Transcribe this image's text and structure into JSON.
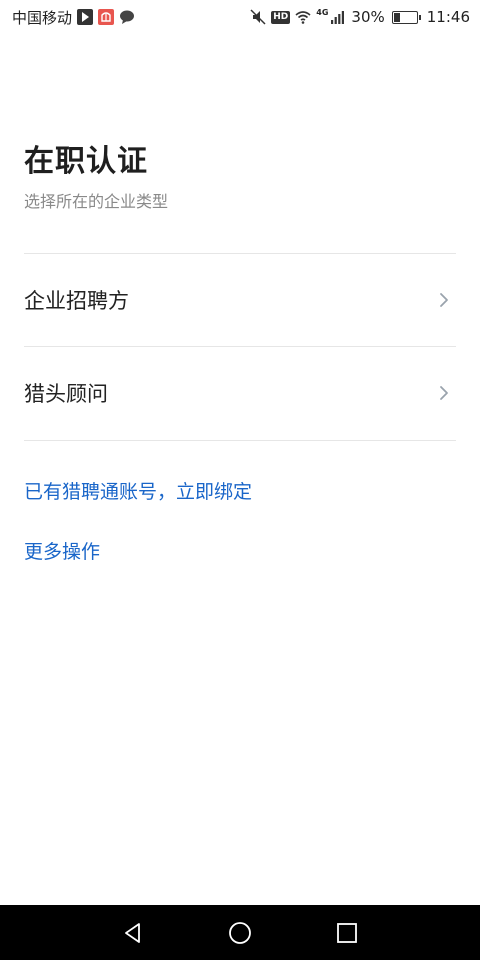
{
  "status_bar": {
    "carrier": "中国移动",
    "network_badge": "HD",
    "network_type": "4G",
    "battery": "30%",
    "battery_level": 0.3,
    "time": "11:46",
    "icons": [
      "play-store-icon",
      "gift-icon",
      "chat-bubble-icon",
      "mute-icon",
      "hd-icon",
      "wifi-icon",
      "signal-icon",
      "battery-icon"
    ]
  },
  "header": {
    "title": "在职认证",
    "subtitle": "选择所在的企业类型"
  },
  "options": [
    {
      "label": "企业招聘方",
      "icon": "chevron-right-icon"
    },
    {
      "label": "猎头顾问",
      "icon": "chevron-right-icon"
    }
  ],
  "links": {
    "bind_account": "已有猎聘通账号，立即绑定",
    "more_actions": "更多操作"
  },
  "colors": {
    "link": "#1a66c9",
    "title": "#1f1f1f",
    "subtitle": "#8a8a8a",
    "divider": "#e6e6e6",
    "nav_bar": "#000000"
  },
  "nav_bar": {
    "icons": [
      "back-icon",
      "home-icon",
      "recents-icon"
    ]
  }
}
